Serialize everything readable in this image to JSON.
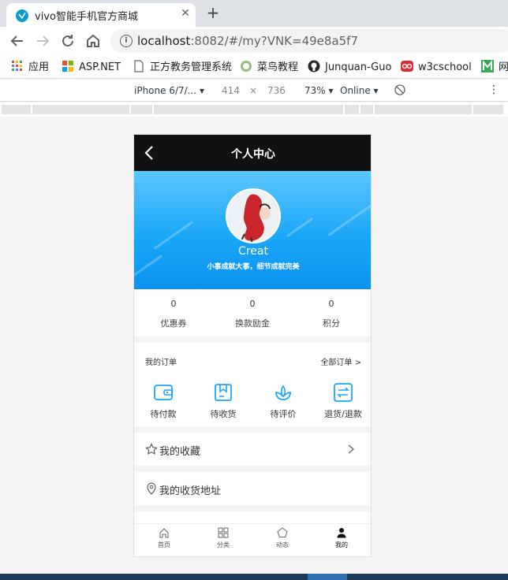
{
  "browser": {
    "tab_title": "vivo智能手机官方商城",
    "url_host": "localhost",
    "url_rest": ":8082/#/my?VNK=49e8a5f7",
    "bookmarks": [
      {
        "label": "应用",
        "icon": "apps-grid-icon"
      },
      {
        "label": "ASP.NET",
        "icon": "windows-logo-icon"
      },
      {
        "label": "正方教务管理系统",
        "icon": "page-icon"
      },
      {
        "label": "菜鸟教程",
        "icon": "runoob-icon"
      },
      {
        "label": "Junquan-Guo",
        "icon": "github-icon"
      },
      {
        "label": "w3cschool",
        "icon": "w3c-icon"
      },
      {
        "label": "网",
        "icon": "m-icon"
      }
    ]
  },
  "devtools": {
    "device": "iPhone 6/7/...",
    "width": "414",
    "times": "×",
    "height": "736",
    "zoom": "73%",
    "network": "Online"
  },
  "phone": {
    "header_title": "个人中心",
    "username": "Creat",
    "motto": "小事成就大事，细节成就完美",
    "stats": [
      {
        "value": "0",
        "label": "优惠券"
      },
      {
        "value": "0",
        "label": "换款励金"
      },
      {
        "value": "0",
        "label": "积分"
      }
    ],
    "orders_title": "我的订单",
    "orders_all": "全部订单 >",
    "order_items": [
      {
        "label": "待付款",
        "icon": "wallet-icon"
      },
      {
        "label": "待收货",
        "icon": "package-icon"
      },
      {
        "label": "待评价",
        "icon": "flower-icon"
      },
      {
        "label": "退货/退款",
        "icon": "exchange-icon"
      }
    ],
    "rows": [
      {
        "label": "我的收藏",
        "icon": "star-icon"
      },
      {
        "label": "我的收货地址",
        "icon": "location-pin-icon"
      }
    ],
    "tabs": [
      {
        "label": "首页",
        "icon": "home-icon"
      },
      {
        "label": "分类",
        "icon": "category-grid-icon"
      },
      {
        "label": "动态",
        "icon": "pentagon-icon"
      },
      {
        "label": "我的",
        "icon": "person-icon"
      }
    ],
    "accent_color": "#1aa7f7"
  }
}
